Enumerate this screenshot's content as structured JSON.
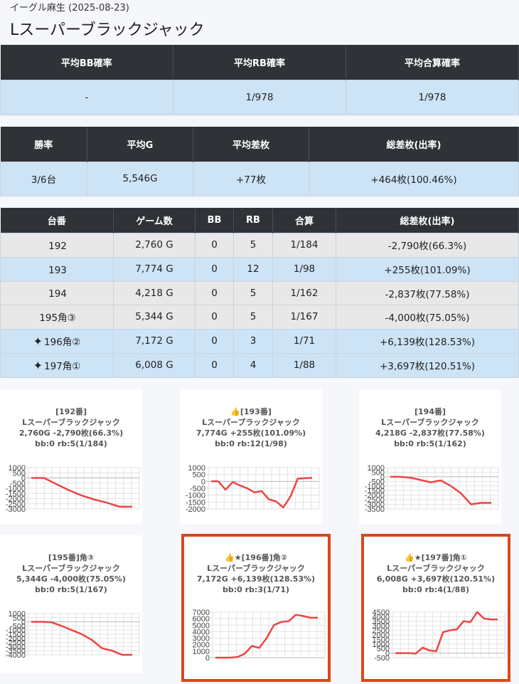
{
  "header": {
    "subtitle": "イーグル麻生 (2025-08-23)",
    "title": "Lスーパーブラックジャック"
  },
  "prob_table": {
    "headers": [
      "平均BB確率",
      "平均RB確率",
      "平均合算確率"
    ],
    "values": [
      "-",
      "1/978",
      "1/978"
    ]
  },
  "summary_table": {
    "headers": [
      "勝率",
      "平均G",
      "平均差枚",
      "総差枚(出率)"
    ],
    "values": [
      "3/6台",
      "5,546G",
      "+77枚",
      "+464枚(100.46%)"
    ]
  },
  "machine_table": {
    "headers": [
      "台番",
      "ゲーム数",
      "BB",
      "RB",
      "合算",
      "総差枚(出率)"
    ],
    "rows": [
      {
        "star": "",
        "id": "192",
        "games": "2,760 G",
        "bb": "0",
        "rb": "5",
        "combined": "1/184",
        "diff": "-2,790枚(66.3%)"
      },
      {
        "star": "",
        "id": "193",
        "games": "7,774 G",
        "bb": "0",
        "rb": "12",
        "combined": "1/98",
        "diff": "+255枚(101.09%)"
      },
      {
        "star": "",
        "id": "194",
        "games": "4,218 G",
        "bb": "0",
        "rb": "5",
        "combined": "1/162",
        "diff": "-2,837枚(77.58%)"
      },
      {
        "star": "",
        "id": "195角③",
        "games": "5,344 G",
        "bb": "0",
        "rb": "5",
        "combined": "1/167",
        "diff": "-4,000枚(75.05%)"
      },
      {
        "star": "✦",
        "id": "196角②",
        "games": "7,172 G",
        "bb": "0",
        "rb": "3",
        "combined": "1/71",
        "diff": "+6,139枚(128.53%)"
      },
      {
        "star": "✦",
        "id": "197角①",
        "games": "6,008 G",
        "bb": "0",
        "rb": "4",
        "combined": "1/88",
        "diff": "+3,697枚(120.51%)"
      }
    ]
  },
  "colors": {
    "line": "#ef4444",
    "highlight": "#d9481e",
    "positive": "#3a8fd8",
    "header_bg": "#2f3338",
    "blue_row": "#cde3f6",
    "gray_row": "#e8e8e8"
  },
  "chart_data": [
    {
      "type": "line",
      "title": [
        "[192番]",
        "Lスーパーブラックジャック",
        "2,760G -2,790枚(66.3%)",
        "bb:0 rb:5(1/184)"
      ],
      "ylim": [
        -3000,
        1000
      ],
      "yticks": [
        1000,
        500,
        0,
        -500,
        -1000,
        -1500,
        -2000,
        -2500,
        -3000
      ],
      "values": [
        0,
        0,
        -600,
        -1200,
        -1700,
        -2100,
        -2400,
        -2790,
        -2790
      ]
    },
    {
      "type": "line",
      "title": [
        "👍[193番]",
        "Lスーパーブラックジャック",
        "7,774G +255枚(101.09%)",
        "bb:0 rb:12(1/98)"
      ],
      "ylim": [
        -2000,
        1000
      ],
      "yticks": [
        1000,
        500,
        0,
        -500,
        -1000,
        -1500,
        -2000
      ],
      "highlight": false,
      "values": [
        0,
        0,
        -600,
        -50,
        -300,
        -500,
        -800,
        -700,
        -1300,
        -1450,
        -1900,
        -1100,
        200,
        230,
        255
      ]
    },
    {
      "type": "line",
      "title": [
        "[194番]",
        "Lスーパーブラックジャック",
        "4,218G -2,837枚(77.58%)",
        "bb:0 rb:5(1/162)"
      ],
      "ylim": [
        -3500,
        1000
      ],
      "yticks": [
        1000,
        500,
        0,
        -500,
        -1000,
        -1500,
        -2000,
        -2500,
        -3000,
        -3500
      ],
      "values": [
        0,
        0,
        -100,
        -350,
        -600,
        -400,
        -1000,
        -1800,
        -3000,
        -2837,
        -2837
      ]
    },
    {
      "type": "line",
      "title": [
        "[195番]角③",
        "Lスーパーブラックジャック",
        "5,344G -4,000枚(75.05%)",
        "bb:0 rb:5(1/167)"
      ],
      "ylim": [
        -4000,
        1000
      ],
      "yticks": [
        1000,
        500,
        0,
        -500,
        -1000,
        -1500,
        -2000,
        -2500,
        -3000,
        -3500,
        -4000
      ],
      "values": [
        0,
        0,
        -50,
        -500,
        -1000,
        -1500,
        -2200,
        -3200,
        -3500,
        -4000,
        -4000
      ]
    },
    {
      "type": "line",
      "title": [
        "👍★[196番]角②",
        "Lスーパーブラックジャック",
        "7,172G +6,139枚(128.53%)",
        "bb:0 rb:3(1/71)"
      ],
      "ylim": [
        0,
        7000
      ],
      "yticks": [
        7000,
        6000,
        5000,
        4000,
        3000,
        2000,
        1000,
        0
      ],
      "values": [
        0,
        0,
        0,
        100,
        600,
        1800,
        1500,
        3000,
        5000,
        5500,
        5600,
        6600,
        6400,
        6139,
        6139
      ]
    },
    {
      "type": "line",
      "title": [
        "👍★[197番]角①",
        "Lスーパーブラックジャック",
        "6,008G +3,697枚(120.51%)",
        "bb:0 rb:4(1/88)"
      ],
      "ylim": [
        -500,
        4500
      ],
      "yticks": [
        4500,
        4000,
        3500,
        3000,
        2500,
        2000,
        1500,
        1000,
        500,
        0,
        -500
      ],
      "values": [
        0,
        0,
        0,
        -50,
        600,
        300,
        200,
        2300,
        2500,
        2600,
        3500,
        3400,
        4500,
        3800,
        3697,
        3697
      ]
    }
  ]
}
